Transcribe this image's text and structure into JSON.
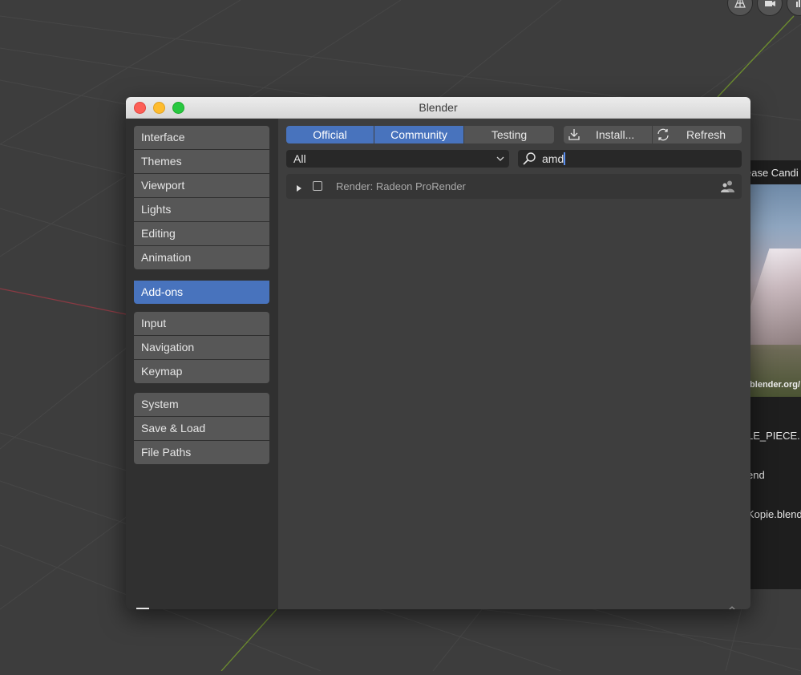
{
  "window": {
    "title": "Blender",
    "traffic_lights": {
      "close": "#fd5f57",
      "minimize": "#febc2e",
      "zoom": "#28c840"
    }
  },
  "sidebar": {
    "group1": [
      {
        "label": "Interface"
      },
      {
        "label": "Themes"
      },
      {
        "label": "Viewport"
      },
      {
        "label": "Lights"
      },
      {
        "label": "Editing"
      },
      {
        "label": "Animation"
      }
    ],
    "group2": [
      {
        "label": "Add-ons",
        "active": true
      }
    ],
    "group3": [
      {
        "label": "Input"
      },
      {
        "label": "Navigation"
      },
      {
        "label": "Keymap"
      }
    ],
    "group4": [
      {
        "label": "System"
      },
      {
        "label": "Save & Load"
      },
      {
        "label": "File Paths"
      }
    ],
    "menu_icon": "hamburger-menu-icon"
  },
  "toolbar": {
    "support_tabs": [
      {
        "label": "Official",
        "active": true
      },
      {
        "label": "Community",
        "active": true
      },
      {
        "label": "Testing",
        "active": false
      }
    ],
    "install_label": "Install...",
    "refresh_label": "Refresh",
    "install_icon": "download-icon",
    "refresh_icon": "refresh-icon"
  },
  "filters": {
    "category_value": "All",
    "search_value": "amd",
    "search_icon": "search-icon"
  },
  "addons": [
    {
      "label": "Render: Radeon ProRender",
      "enabled": false,
      "expanded": false,
      "support_icon": "community-users-icon"
    }
  ],
  "background_splash": {
    "release_text": "ease Candi",
    "url_text": ".blender.org/",
    "recent_files": [
      "LE_PIECE.",
      "end",
      "Kopie.blend"
    ]
  },
  "colors": {
    "accent": "#4873bd",
    "viewport_bg": "#3d3d3d",
    "panel_bg": "#3e3e3e",
    "sidebar_bg": "#303030",
    "button_bg": "#575757"
  }
}
